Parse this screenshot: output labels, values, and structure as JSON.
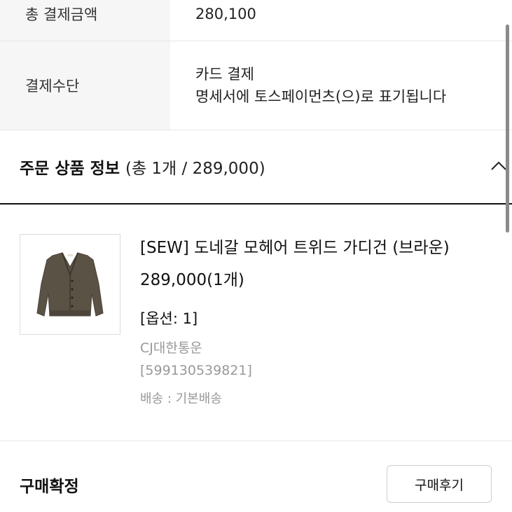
{
  "payment": {
    "total_label": "총 결제금액",
    "total_value": "280,100",
    "method_label": "결제수단",
    "method_value": "카드 결제",
    "method_note": "명세서에 토스페이먼츠(으)로 표기됩니다"
  },
  "order_section": {
    "title": "주문 상품 정보",
    "summary": "(총 1개 / 289,000)",
    "collapse_icon": "chevron-up-icon"
  },
  "product": {
    "name": "[SEW] 도네갈 모헤어 트위드 가디건 (브라운)",
    "price": "289,000(1개)",
    "option": "[옵션: 1]",
    "courier": "CJ대한통운",
    "tracking": "[599130539821]",
    "shipping": "배송 : 기본배송",
    "image_color": "#5b5246"
  },
  "purchase_confirm": {
    "title": "구매확정",
    "review_button": "구매후기"
  }
}
